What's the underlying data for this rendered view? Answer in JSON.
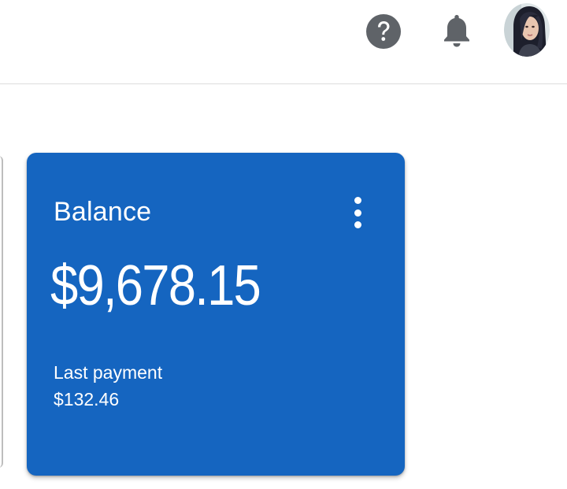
{
  "header": {
    "help_icon": "help-circle-icon",
    "notifications_icon": "bell-icon",
    "avatar": "user-avatar"
  },
  "balance_card": {
    "title": "Balance",
    "amount": "$9,678.15",
    "last_payment_label": "Last payment",
    "last_payment_value": "$132.46",
    "menu_icon": "more-vert-icon"
  },
  "colors": {
    "card_background": "#1565c0",
    "icon_gray": "#5f6368"
  }
}
